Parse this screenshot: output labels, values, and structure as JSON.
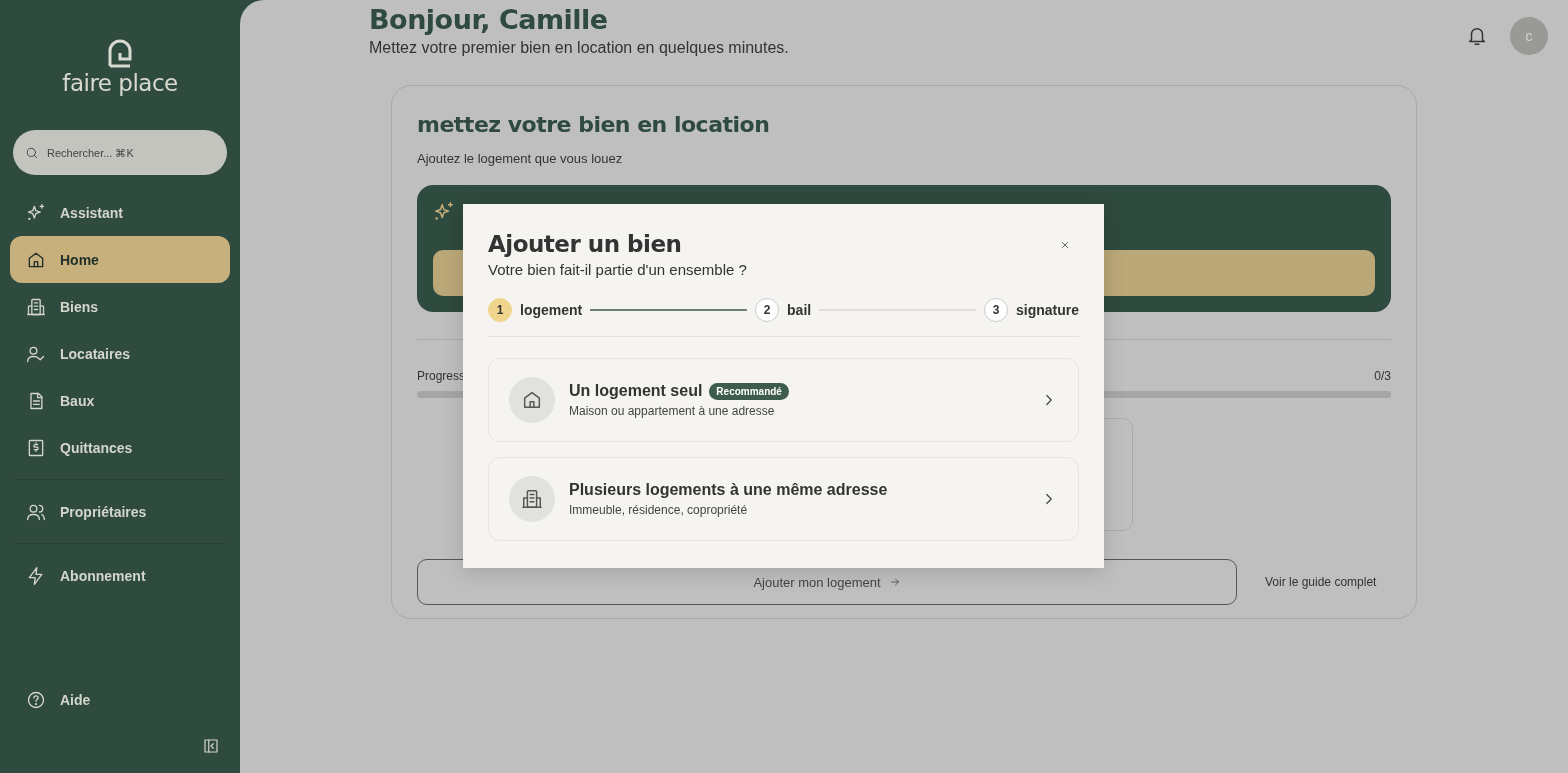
{
  "sidebar": {
    "logo": "faire place",
    "search": {
      "placeholder": "Rechercher... ⌘K"
    },
    "sections": [
      [
        {
          "label": "Assistant",
          "selected": false
        },
        {
          "label": "Home",
          "selected": true
        },
        {
          "label": "Biens",
          "selected": false
        },
        {
          "label": "Locataires",
          "selected": false
        },
        {
          "label": "Baux",
          "selected": false
        },
        {
          "label": "Quittances",
          "selected": false
        }
      ],
      [
        {
          "label": "Propriétaires",
          "selected": false
        }
      ],
      [
        {
          "label": "Abonnement",
          "selected": false
        }
      ]
    ],
    "help": "Aide"
  },
  "header": {
    "greeting": "Bonjour, Camille",
    "subtitle": "Mettez votre premier bien en location en quelques minutes.",
    "avatar": "c"
  },
  "card": {
    "title": "mettez votre bien en location",
    "subtitle": "Ajoutez le logement que vous louez",
    "progress_label": "Progress",
    "progress_count": "0/3",
    "progress": {
      "level": 0
    },
    "primary_button": "Ajouter mon logement",
    "link": "Voir le guide complet"
  },
  "modal": {
    "title": "Ajouter un bien",
    "subtitle": "Votre bien fait-il partie d'un ensemble ?",
    "steps": [
      {
        "number": "1",
        "label": "logement",
        "selected": true
      },
      {
        "number": "2",
        "label": "bail",
        "selected": false
      },
      {
        "number": "3",
        "label": "signature",
        "selected": false
      }
    ],
    "options": [
      {
        "title": "Un logement seul",
        "badge": "Recommandé",
        "description": "Maison ou appartement à une adresse"
      },
      {
        "title": "Plusieurs logements à une même adresse",
        "description": "Immeuble, résidence, copropriété"
      }
    ]
  }
}
